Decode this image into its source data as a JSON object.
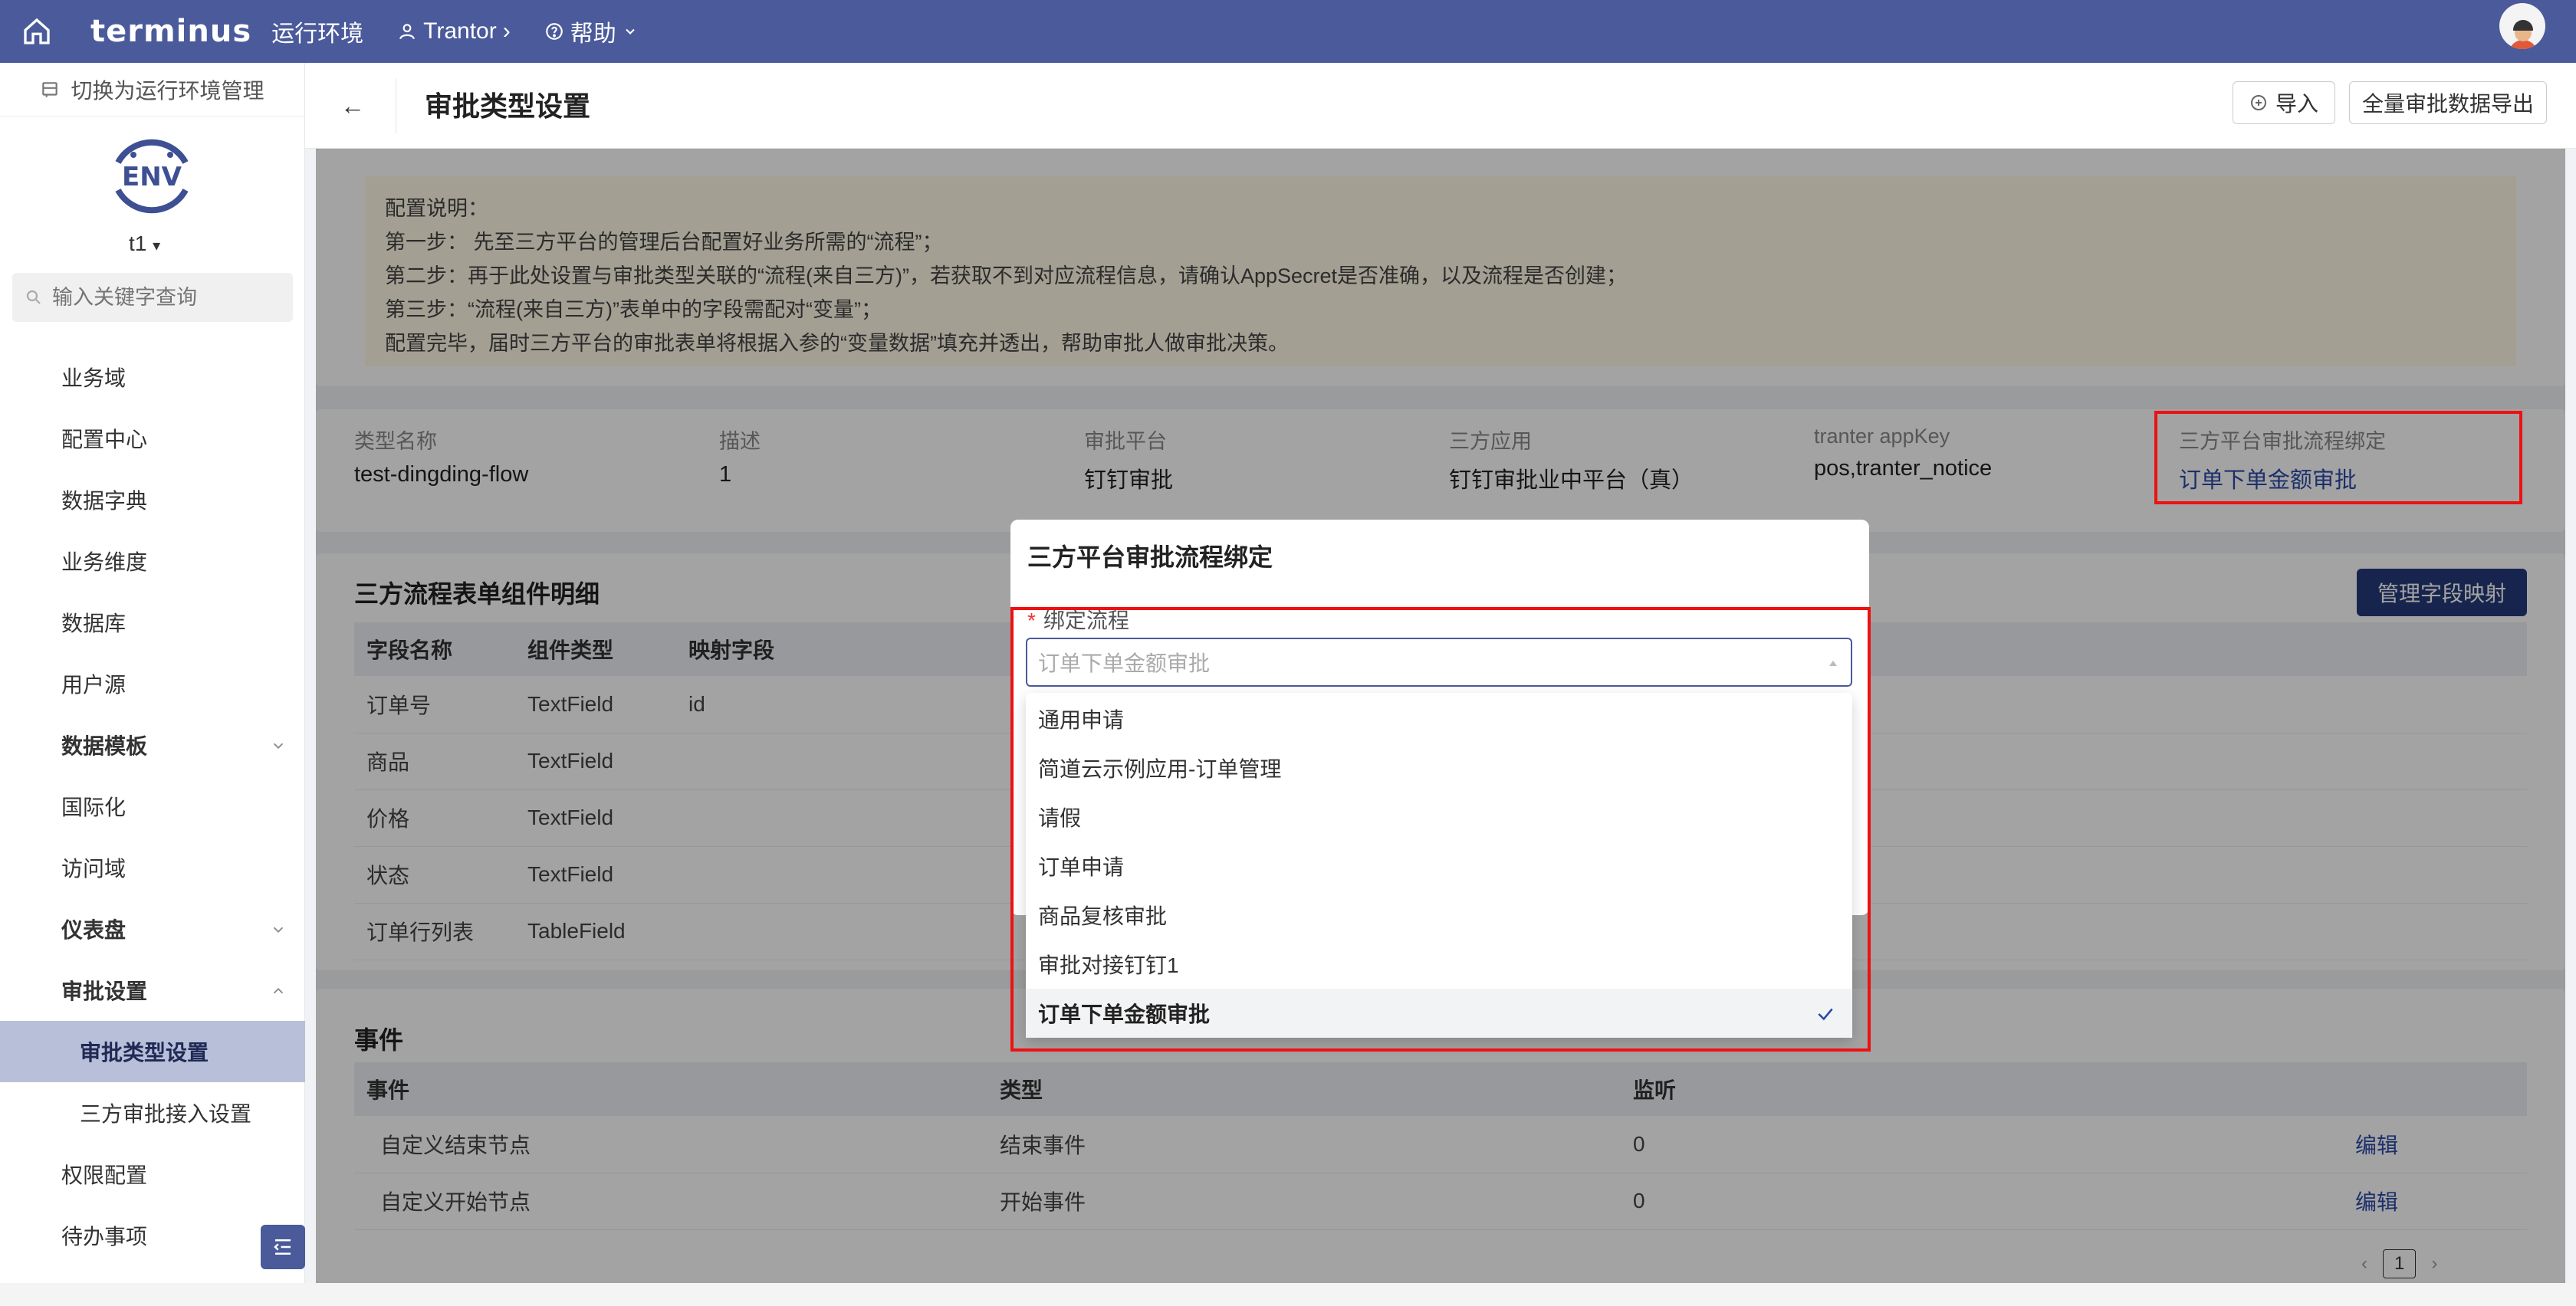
{
  "topbar": {
    "logo": "terminus",
    "env_label": "运行环境",
    "user": "Trantor",
    "help": "帮助"
  },
  "sidebar": {
    "switch_label": "切换为运行环境管理",
    "env_logo_text": "ENV",
    "env_name": "t1",
    "search_placeholder": "输入关键字查询",
    "items": [
      {
        "label": "业务域"
      },
      {
        "label": "配置中心"
      },
      {
        "label": "数据字典"
      },
      {
        "label": "业务维度"
      },
      {
        "label": "数据库"
      },
      {
        "label": "用户源"
      },
      {
        "label": "数据模板"
      },
      {
        "label": "国际化"
      },
      {
        "label": "访问域"
      },
      {
        "label": "仪表盘"
      },
      {
        "label": "审批设置"
      },
      {
        "label": "审批类型设置"
      },
      {
        "label": "三方审批接入设置"
      },
      {
        "label": "权限配置"
      },
      {
        "label": "待办事项"
      }
    ]
  },
  "page": {
    "title": "审批类型设置",
    "import_label": "导入",
    "export_label": "全量审批数据导出"
  },
  "notice": {
    "lines": [
      "配置说明：",
      "第一步： 先至三方平台的管理后台配置好业务所需的“流程”；",
      "第二步：再于此处设置与审批类型关联的“流程(来自三方)”，若获取不到对应流程信息，请确认AppSecret是否准确，以及流程是否创建；",
      "第三步：“流程(来自三方)”表单中的字段需配对“变量”；",
      "配置完毕，届时三方平台的审批表单将根据入参的“变量数据”填充并透出，帮助审批人做审批决策。"
    ]
  },
  "info": {
    "fields": [
      {
        "key": "类型名称",
        "value": "test-dingding-flow"
      },
      {
        "key": "描述",
        "value": "1"
      },
      {
        "key": "审批平台",
        "value": "钉钉审批"
      },
      {
        "key": "三方应用",
        "value": "钉钉审批业中平台（真）"
      },
      {
        "key": "tranter appKey",
        "value": "pos,tranter_notice"
      },
      {
        "key": "三方平台审批流程绑定",
        "value": "订单下单金额审批"
      }
    ]
  },
  "form_table": {
    "title": "三方流程表单组件明细",
    "manage_button": "管理字段映射",
    "headers": [
      "字段名称",
      "组件类型",
      "映射字段"
    ],
    "rows": [
      [
        "订单号",
        "TextField",
        "id"
      ],
      [
        "商品",
        "TextField",
        ""
      ],
      [
        "价格",
        "TextField",
        ""
      ],
      [
        "状态",
        "TextField",
        ""
      ],
      [
        "订单行列表",
        "TableField",
        ""
      ]
    ]
  },
  "events": {
    "title": "事件",
    "headers": [
      "事件",
      "类型",
      "监听"
    ],
    "rows": [
      {
        "event": "自定义结束节点",
        "type": "结束事件",
        "listen": "0",
        "action": "编辑"
      },
      {
        "event": "自定义开始节点",
        "type": "开始事件",
        "listen": "0",
        "action": "编辑"
      }
    ],
    "page": "1"
  },
  "modal": {
    "title": "三方平台审批流程绑定",
    "field_label": "绑定流程",
    "required_mark": "*",
    "select_placeholder": "订单下单金额审批",
    "options": [
      {
        "label": "通用申请",
        "selected": false
      },
      {
        "label": "简道云示例应用-订单管理",
        "selected": false
      },
      {
        "label": "请假",
        "selected": false
      },
      {
        "label": "订单申请",
        "selected": false
      },
      {
        "label": "商品复核审批",
        "selected": false
      },
      {
        "label": "审批对接钉钉1",
        "selected": false
      },
      {
        "label": "订单下单金额审批",
        "selected": true
      }
    ]
  },
  "colors": {
    "topbar": "#4a5a9b",
    "highlight": "#e11111",
    "link": "#2b4aa8"
  }
}
